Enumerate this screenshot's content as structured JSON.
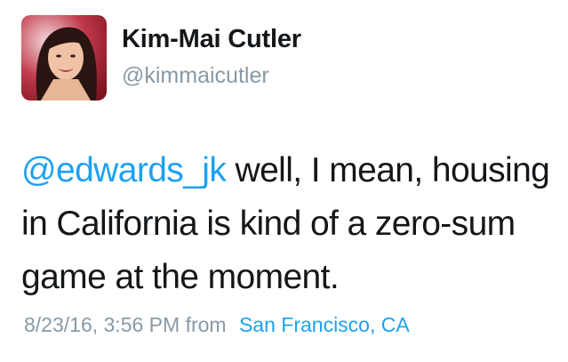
{
  "author": {
    "name": "Kim-Mai Cutler",
    "handle": "@kimmaicutler"
  },
  "tweet": {
    "mention": "@edwards_jk",
    "text": " well, I mean, housing in California is kind of a zero-sum game at the moment."
  },
  "meta": {
    "timestamp": "8/23/16, 3:56 PM",
    "from_label": "from",
    "location": "San Francisco, CA"
  },
  "colors": {
    "link": "#1da1f2",
    "secondary": "#8899a6",
    "text": "#14171a"
  }
}
